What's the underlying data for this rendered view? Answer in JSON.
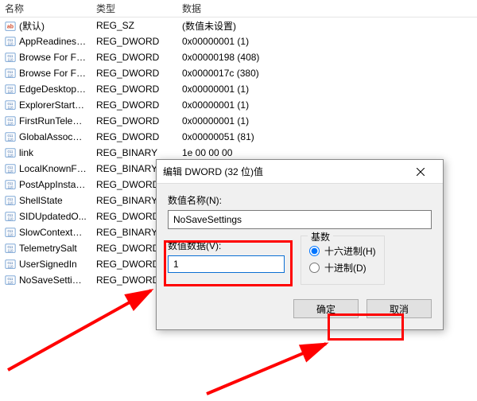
{
  "header": {
    "name": "名称",
    "type": "类型",
    "data": "数据"
  },
  "rows": [
    {
      "icon": "str",
      "name": "(默认)",
      "type": "REG_SZ",
      "data": "(数值未设置)"
    },
    {
      "icon": "bin",
      "name": "AppReadiness...",
      "type": "REG_DWORD",
      "data": "0x00000001 (1)"
    },
    {
      "icon": "bin",
      "name": "Browse For Fol...",
      "type": "REG_DWORD",
      "data": "0x00000198 (408)"
    },
    {
      "icon": "bin",
      "name": "Browse For Fol...",
      "type": "REG_DWORD",
      "data": "0x0000017c (380)"
    },
    {
      "icon": "bin",
      "name": "EdgeDesktopS...",
      "type": "REG_DWORD",
      "data": "0x00000001 (1)"
    },
    {
      "icon": "bin",
      "name": "ExplorerStartu...",
      "type": "REG_DWORD",
      "data": "0x00000001 (1)"
    },
    {
      "icon": "bin",
      "name": "FirstRunTelem...",
      "type": "REG_DWORD",
      "data": "0x00000001 (1)"
    },
    {
      "icon": "bin",
      "name": "GlobalAssocCh...",
      "type": "REG_DWORD",
      "data": "0x00000051 (81)"
    },
    {
      "icon": "bin",
      "name": "link",
      "type": "REG_BINARY",
      "data": "1e 00 00 00"
    },
    {
      "icon": "bin",
      "name": "LocalKnownFol...",
      "type": "REG_BINARY",
      "data": ""
    },
    {
      "icon": "bin",
      "name": "PostAppInstall...",
      "type": "REG_DWORD",
      "data": ""
    },
    {
      "icon": "bin",
      "name": "ShellState",
      "type": "REG_BINARY",
      "data": ""
    },
    {
      "icon": "bin",
      "name": "SIDUpdatedO...",
      "type": "REG_DWORD",
      "data": ""
    },
    {
      "icon": "bin",
      "name": "SlowContextM...",
      "type": "REG_BINARY",
      "data": ""
    },
    {
      "icon": "bin",
      "name": "TelemetrySalt",
      "type": "REG_DWORD",
      "data": ""
    },
    {
      "icon": "bin",
      "name": "UserSignedIn",
      "type": "REG_DWORD",
      "data": ""
    },
    {
      "icon": "bin",
      "name": "NoSaveSettings",
      "type": "REG_DWORD",
      "data": ""
    }
  ],
  "dialog": {
    "title": "编辑 DWORD (32 位)值",
    "name_label": "数值名称(N):",
    "name_value": "NoSaveSettings",
    "value_label": "数值数据(V):",
    "value_data": "1",
    "radix_legend": "基数",
    "radix_hex": "十六进制(H)",
    "radix_dec": "十进制(D)",
    "ok": "确定",
    "cancel": "取消"
  }
}
